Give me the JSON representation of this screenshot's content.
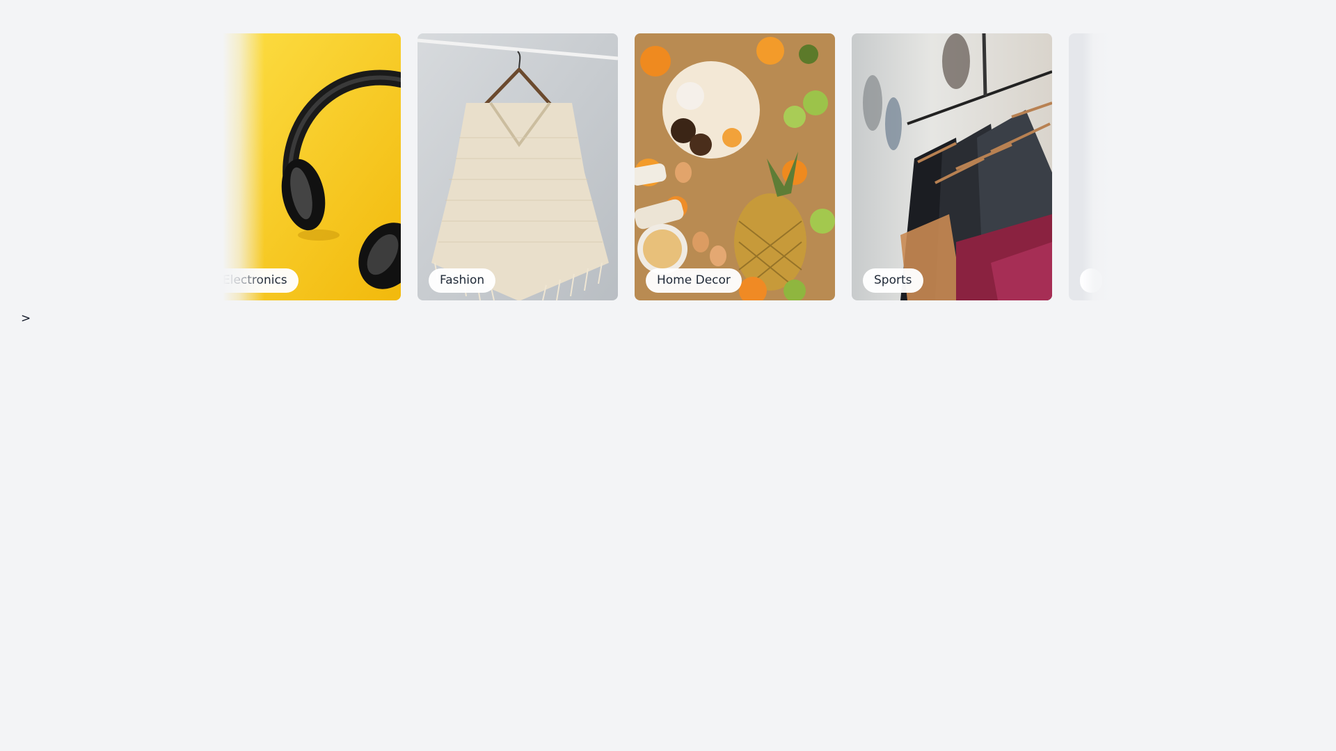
{
  "carousel": {
    "cards": [
      {
        "label": "Electronics",
        "image": "yellow-headphones-photo"
      },
      {
        "label": "Fashion",
        "image": "knit-poncho-on-hanger-photo"
      },
      {
        "label": "Home Decor",
        "image": "food-spread-table-photo"
      },
      {
        "label": "Sports",
        "image": "clothing-rack-photo"
      },
      {
        "label": "",
        "image": "faded-partial-card"
      }
    ],
    "next_label": ">"
  },
  "colors": {
    "background": "#f3f4f6",
    "label_bg": "#ffffff",
    "label_text": "#1f2937",
    "electronics_yellow": "#f8cf1c"
  }
}
